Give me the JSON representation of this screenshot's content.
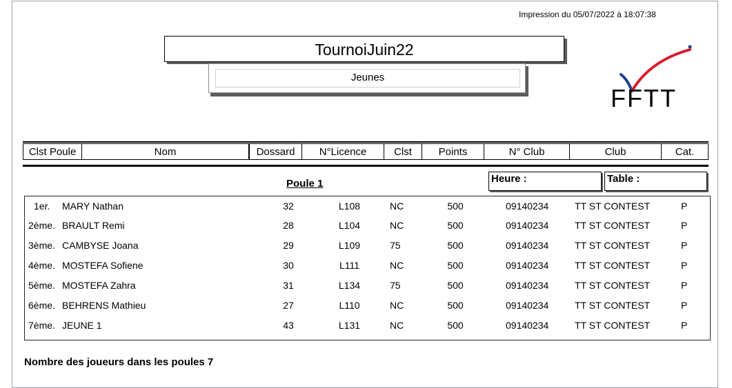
{
  "printed_on": "Impression du 05/07/2022 à 18:07:38",
  "tournament": {
    "title": "TournoiJuin22",
    "category": "Jeunes"
  },
  "logo": {
    "text": "FFTT",
    "icon": "fftt-logo-icon"
  },
  "columns": [
    "Clst Poule",
    "Nom",
    "Dossard",
    "N°Licence",
    "Clst",
    "Points",
    "N° Club",
    "Club",
    "Cat."
  ],
  "poule": {
    "title": "Poule 1",
    "heure_label": "Heure :",
    "table_label": "Table :"
  },
  "players": [
    {
      "rank": "1er.",
      "name": "MARY Nathan",
      "dossard": "32",
      "licence": "L108",
      "clst": "NC",
      "points": "500",
      "club_num": "09140234",
      "club": "TT ST CONTEST",
      "cat": "P"
    },
    {
      "rank": "2ème.",
      "name": "BRAULT Remi",
      "dossard": "28",
      "licence": "L104",
      "clst": "NC",
      "points": "500",
      "club_num": "09140234",
      "club": "TT ST CONTEST",
      "cat": "P"
    },
    {
      "rank": "3ème.",
      "name": "CAMBYSE Joana",
      "dossard": "29",
      "licence": "L109",
      "clst": "75",
      "points": "500",
      "club_num": "09140234",
      "club": "TT ST CONTEST",
      "cat": "P"
    },
    {
      "rank": "4ème.",
      "name": "MOSTEFA Sofiene",
      "dossard": "30",
      "licence": "L111",
      "clst": "NC",
      "points": "500",
      "club_num": "09140234",
      "club": "TT ST CONTEST",
      "cat": "P"
    },
    {
      "rank": "5ème.",
      "name": "MOSTEFA Zahra",
      "dossard": "31",
      "licence": "L134",
      "clst": "75",
      "points": "500",
      "club_num": "09140234",
      "club": "TT ST CONTEST",
      "cat": "P"
    },
    {
      "rank": "6ème.",
      "name": "BEHRENS Mathieu",
      "dossard": "27",
      "licence": "L110",
      "clst": "NC",
      "points": "500",
      "club_num": "09140234",
      "club": "TT ST CONTEST",
      "cat": "P"
    },
    {
      "rank": "7ème.",
      "name": "JEUNE 1",
      "dossard": "43",
      "licence": "L131",
      "clst": "NC",
      "points": "500",
      "club_num": "09140234",
      "club": "TT ST CONTEST",
      "cat": "P"
    }
  ],
  "footer": {
    "label": "Nombre des joueurs dans les poules",
    "count": "7"
  }
}
